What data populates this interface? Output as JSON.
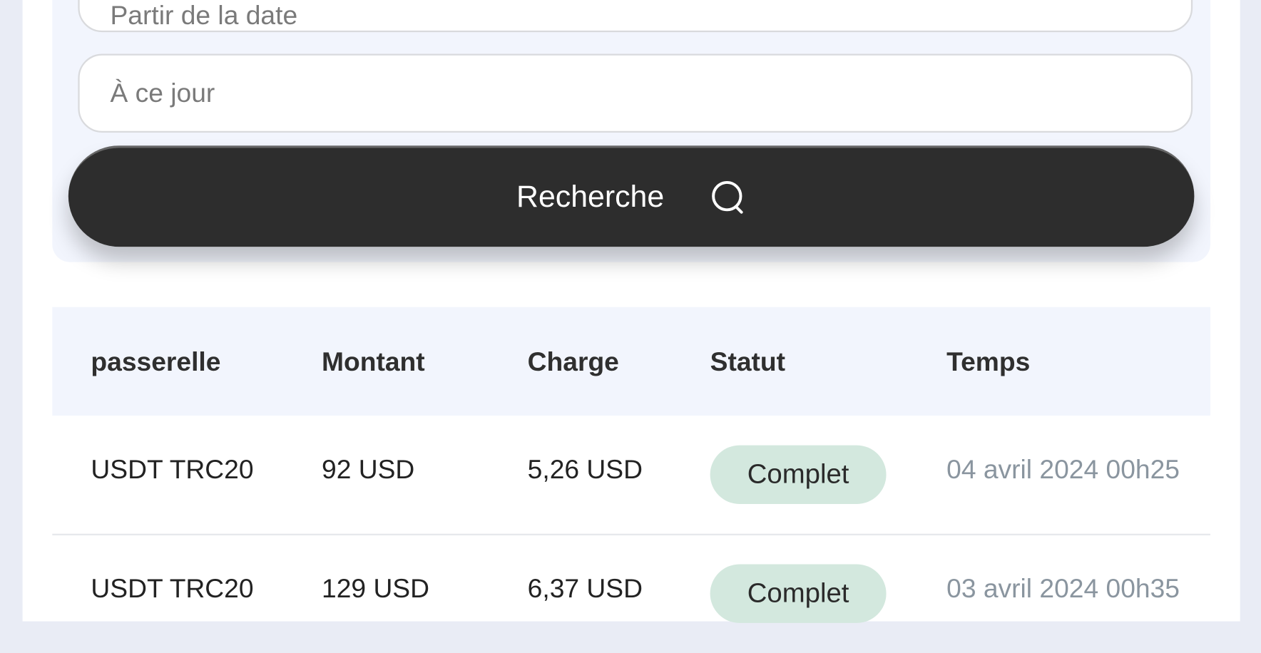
{
  "filters": {
    "from_placeholder": "Partir de la date",
    "to_placeholder": "À ce jour",
    "search_label": "Recherche",
    "search_icon": "search-icon"
  },
  "table": {
    "headers": [
      "passerelle",
      "Montant",
      "Charge",
      "Statut",
      "Temps"
    ],
    "rows": [
      {
        "gateway": "USDT TRC20",
        "amount": "92 USD",
        "charge": "5,26 USD",
        "status": "Complet",
        "time": "04 avril 2024 00h25"
      },
      {
        "gateway": "USDT TRC20",
        "amount": "129 USD",
        "charge": "6,37 USD",
        "status": "Complet",
        "time": "03 avril 2024 00h35"
      }
    ]
  },
  "colors": {
    "button": "#2d2d2d",
    "status_complete": "#d3e8de",
    "header_bg": "#f2f5fd"
  }
}
